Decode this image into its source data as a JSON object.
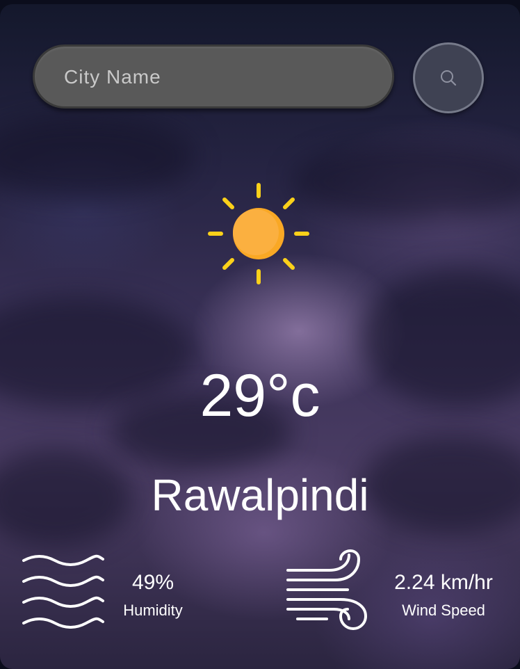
{
  "search": {
    "placeholder": "City Name",
    "button_icon": "search-icon"
  },
  "weather": {
    "condition_icon": "sun-icon",
    "temperature": "29°c",
    "city": "Rawalpindi"
  },
  "details": {
    "humidity": {
      "icon": "humidity-waves-icon",
      "value": "49%",
      "label": "Humidity"
    },
    "wind": {
      "icon": "wind-icon",
      "value": "2.24 km/hr",
      "label": "Wind Speed"
    }
  },
  "colors": {
    "sun": "#f9a825",
    "sun_rays": "#fbd11a",
    "search_bar": "#595959",
    "text": "#ffffff"
  }
}
